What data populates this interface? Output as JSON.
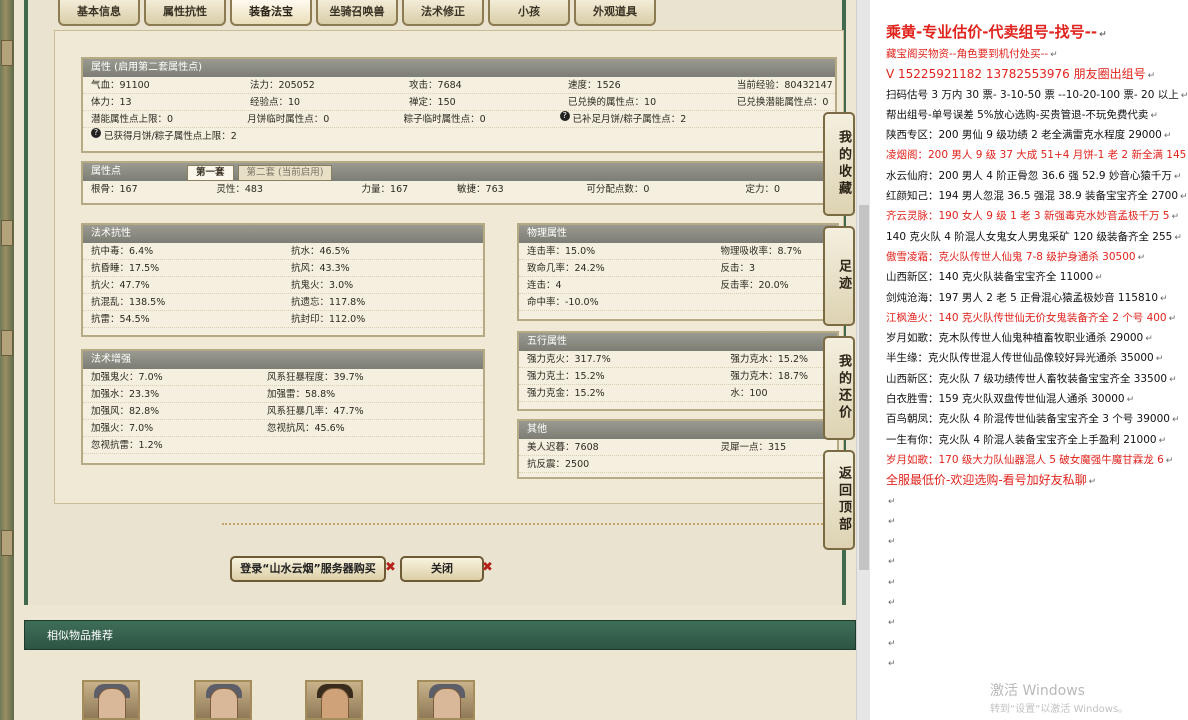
{
  "tabs": [
    "基本信息",
    "属性抗性",
    "装备法宝",
    "坐骑召唤兽",
    "法术修正",
    "小孩",
    "外观道具"
  ],
  "attr_box": {
    "title": "属性 (启用第二套属性点)",
    "rows": [
      [
        "气血：91100",
        "法力：205052",
        "攻击：7684",
        "速度：1526",
        "当前经验：80432147"
      ],
      [
        "体力：13",
        "经验点：10",
        "禅定：150",
        "已兑换的属性点：10",
        "已兑换潜能属性点：0"
      ],
      [
        "潜能属性点上限：0",
        "月饼临时属性点：0",
        "粽子临时属性点：0",
        "已补足月饼/粽子属性点：2",
        ""
      ]
    ],
    "note": "已获得月饼/粽子属性点上限：2"
  },
  "points_box": {
    "title": "属性点",
    "subtab1": "第一套",
    "subtab2": "第二套 (当前启用)",
    "row": [
      "根骨：167",
      "灵性：483",
      "力量：167",
      "敏捷：763",
      "可分配点数：0",
      "定力：0"
    ]
  },
  "spell_resist": {
    "title": "法术抗性",
    "rows": [
      [
        "抗中毒：6.4%",
        "抗水：46.5%"
      ],
      [
        "抗昏睡：17.5%",
        "抗风：43.3%"
      ],
      [
        "抗火：47.7%",
        "抗鬼火：3.0%"
      ],
      [
        "抗混乱：138.5%",
        "抗遗忘：117.8%"
      ],
      [
        "抗雷：54.5%",
        "抗封印：112.0%"
      ]
    ]
  },
  "spell_boost": {
    "title": "法术增强",
    "rows": [
      [
        "加强鬼火：7.0%",
        "风系狂暴程度：39.7%"
      ],
      [
        "加强水：23.3%",
        "加强雷：58.8%"
      ],
      [
        "加强风：82.8%",
        "风系狂暴几率：47.7%"
      ],
      [
        "加强火：7.0%",
        "忽视抗风：45.6%"
      ],
      [
        "忽视抗雷：1.2%",
        ""
      ]
    ]
  },
  "physical": {
    "title": "物理属性",
    "rows": [
      [
        "连击率：15.0%",
        "物理吸收率：8.7%"
      ],
      [
        "致命几率：24.2%",
        "反击：3"
      ],
      [
        "连击：4",
        "反击率：20.0%"
      ],
      [
        "命中率：-10.0%",
        ""
      ]
    ]
  },
  "wuxing": {
    "title": "五行属性",
    "rows": [
      [
        "强力克火：317.7%",
        "强力克水：15.2%"
      ],
      [
        "强力克土：15.2%",
        "强力克木：18.7%"
      ],
      [
        "强力克金：15.2%",
        "水：100"
      ]
    ]
  },
  "other": {
    "title": "其他",
    "rows": [
      [
        "美人迟暮：7608",
        "灵犀一点：315"
      ],
      [
        "抗反震：2500",
        ""
      ]
    ]
  },
  "buttons": {
    "login": "登录“山水云烟”服务器购买",
    "close": "关闭"
  },
  "similar_title": "相似物品推荐",
  "sidenav": [
    "我的收藏",
    "足迹",
    "我的还价",
    "返回顶部"
  ],
  "doc_lines": [
    {
      "t": "乘黄-专业估价-代卖组号-找号--",
      "s": "title"
    },
    {
      "t": "藏宝阁买物资--角色要到机付处买--",
      "s": "red"
    },
    {
      "t": "V 15225921182  13782553976 朋友圈出组号",
      "s": "bigred"
    },
    {
      "t": "扫码估号 3 万内 30 票- 3-10-50 票  --10-20-100 票- 20 以上",
      "s": ""
    },
    {
      "t": "帮出组号-单号误差 5%放心选购-买贵管退-不玩免费代卖",
      "s": ""
    },
    {
      "t": "陕西专区：200 男仙 9 级功绩 2 老全满雷克水程度 29000",
      "s": ""
    },
    {
      "t": "凌烟阁：200 男人 9 级 37 大成 51+4 月饼-1 老 2 新全满 145",
      "s": "red"
    },
    {
      "t": "水云仙府：200 男人 4 阶正骨忽 36.6 强 52.9 妙音心猿千万",
      "s": ""
    },
    {
      "t": "红颜知己：194 男人忽混 36.5 强混 38.9 装备宝宝齐全 2700",
      "s": ""
    },
    {
      "t": "齐云灵脉：190 女人 9 级 1 老 3 新强毒克水妙音孟极千万 5",
      "s": "red"
    },
    {
      "t": "140 克火队 4 阶混人女鬼女人男鬼采矿 120 级装备齐全 255",
      "s": ""
    },
    {
      "t": "傲雪凌霜：克火队传世人仙鬼 7-8 级护身通杀 30500",
      "s": "red"
    },
    {
      "t": "山西新区：140 克火队装备宝宝齐全 11000",
      "s": ""
    },
    {
      "t": "剑炖沧海：197 男人 2 老 5 正骨混心猿孟极妙音 115810",
      "s": ""
    },
    {
      "t": "江枫渔火：140 克火队传世仙无价女鬼装备齐全 2 个号 400",
      "s": "red"
    },
    {
      "t": "岁月如歌：克木队传世人仙鬼种植畜牧职业通杀 29000",
      "s": ""
    },
    {
      "t": "半生缘：克火队传世混人传世仙品像较好异光通杀 35000",
      "s": ""
    },
    {
      "t": "山西新区：克火队 7 级功绩传世人畜牧装备宝宝齐全 33500",
      "s": ""
    },
    {
      "t": "白衣胜雪：159 克火队双盘传世仙混人通杀 30000",
      "s": ""
    },
    {
      "t": "百鸟朝凤：克火队 4 阶混传世仙装备宝宝齐全 3 个号 39000",
      "s": ""
    },
    {
      "t": "一生有你：克火队 4 阶混人装备宝宝齐全上手盈利 21000",
      "s": ""
    },
    {
      "t": "岁月如歌：170 级大力队仙器混人 5 破女魔强牛魔甘霖龙 6",
      "s": "red"
    },
    {
      "t": "全服最低价-欢迎选购-看号加好友私聊",
      "s": "bigred"
    }
  ],
  "watermark": {
    "line1": "激活 Windows",
    "line2": "转到“设置”以激活 Windows。"
  }
}
